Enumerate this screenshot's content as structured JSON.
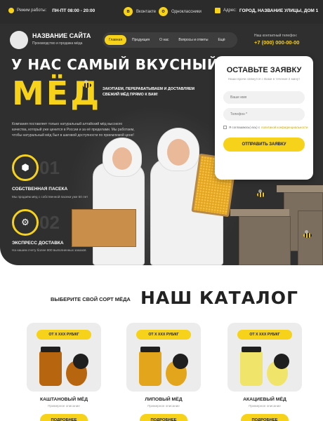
{
  "topbar": {
    "hours_label": "Режим работы:",
    "hours_value": "ПН-ПТ 08:00 - 20:00",
    "social1": "Вконтакте",
    "social2": "Одноклассники",
    "address_label": "Адрес:",
    "address_value": "ГОРОД, НАЗВАНИЕ УЛИЦЫ, ДОМ 1"
  },
  "header": {
    "site_name": "НАЗВАНИЕ САЙТА",
    "site_sub": "Производство и продажа мёда",
    "nav": [
      "Главная",
      "Продукция",
      "О нас",
      "Вопросы и ответы",
      "Ещё"
    ],
    "phone_label": "Наш контактный телефон:",
    "phone": "+7 (000) 000-00-00"
  },
  "hero": {
    "title": "У НАС САМЫЙ ВКУСНЫЙ",
    "honey": "МЁД",
    "tagline": "ЗАКУПАЕМ, ПЕРЕРАБАТЫВАЕМ И ДОСТАВЛЯЕМ СВЕЖИЙ МЁД ПРЯМО К ВАМ!",
    "description": "Компания поставляет только натуральный алтайский мёд высокого качества, который уже ценится в России и за её пределами. Мы работаем, чтобы натуральный мёд был в шаговой доступности по приемлемой цене!",
    "features": [
      {
        "num": "01",
        "title": "СОБСТВЕННАЯ ПАСЕКА",
        "text": "Мы продаём мёд с собственной пасеки уже 50 лет"
      },
      {
        "num": "02",
        "title": "ЭКСПРЕСС ДОСТАВКА",
        "text": "На нашем счету более 800 выполненных заказов"
      }
    ]
  },
  "form": {
    "title": "ОСТАВЬТЕ ЗАЯВКУ",
    "subtitle": "Наши врачи свяжутся с Вами в течение 2 минут",
    "name_placeholder": "Ваше имя",
    "phone_placeholder": "Телефон *",
    "consent_text": "Я соглашаюсь(-ась) с",
    "consent_link": "политикой конфиденциальности",
    "submit": "ОТПРАВИТЬ ЗАЯВКУ"
  },
  "catalog": {
    "subtitle": "выберите свой сорт мёда",
    "title": "НАШ КАТАЛОГ",
    "products": [
      {
        "price": "ОТ X XXX РУБ/КГ",
        "name": "КАШТАНОВЫЙ МЁД",
        "desc": "Примерное описание",
        "button": "ПОДРОБНЕЕ",
        "color": "#b8650f"
      },
      {
        "price": "ОТ X XXX РУБ/КГ",
        "name": "ЛИПОВЫЙ МЁД",
        "desc": "Примерное описание",
        "button": "ПОДРОБНЕЕ",
        "color": "#e3a51c"
      },
      {
        "price": "ОТ X XXX РУБ/КГ",
        "name": "АКАЦИЕВЫЙ МЁД",
        "desc": "Примерное описание",
        "button": "ПОДРОБНЕЕ",
        "color": "#f1e46b"
      }
    ]
  },
  "colors": {
    "accent": "#f6d21b",
    "dark": "#2f2f2f"
  }
}
